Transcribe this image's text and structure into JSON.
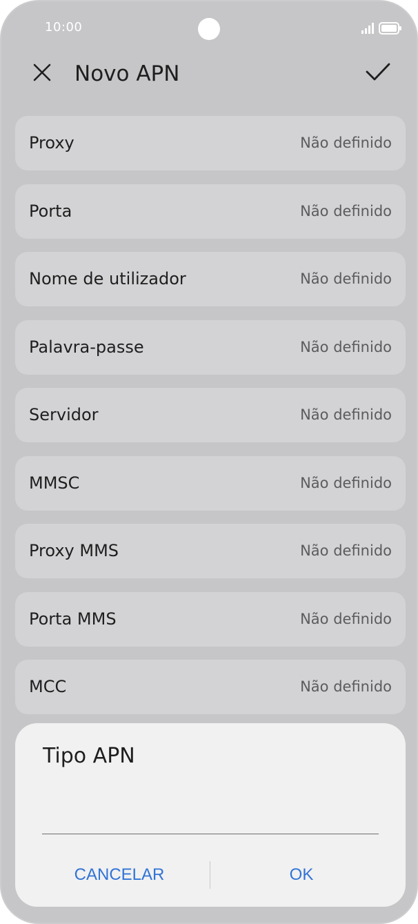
{
  "status_bar": {
    "time": "10:00",
    "icons": [
      "signal-icon",
      "battery-icon"
    ]
  },
  "header": {
    "title": "Novo APN",
    "close_icon": "close-icon",
    "confirm_icon": "check-icon"
  },
  "fields": [
    {
      "label": "Proxy",
      "value": "Não definido"
    },
    {
      "label": "Porta",
      "value": "Não definido"
    },
    {
      "label": "Nome de utilizador",
      "value": "Não definido"
    },
    {
      "label": "Palavra-passe",
      "value": "Não definido"
    },
    {
      "label": "Servidor",
      "value": "Não definido"
    },
    {
      "label": "MMSC",
      "value": "Não definido"
    },
    {
      "label": "Proxy MMS",
      "value": "Não definido"
    },
    {
      "label": "Porta MMS",
      "value": "Não definido"
    },
    {
      "label": "MCC",
      "value": "Não definido"
    }
  ],
  "dialog": {
    "title": "Tipo APN",
    "input_value": "",
    "cancel_label": "CANCELAR",
    "ok_label": "OK"
  },
  "colors": {
    "accent": "#3173d6",
    "scrim": "#c6c6c8",
    "row_bg": "#d3d3d5",
    "dialog_bg": "#f1f1f1"
  }
}
